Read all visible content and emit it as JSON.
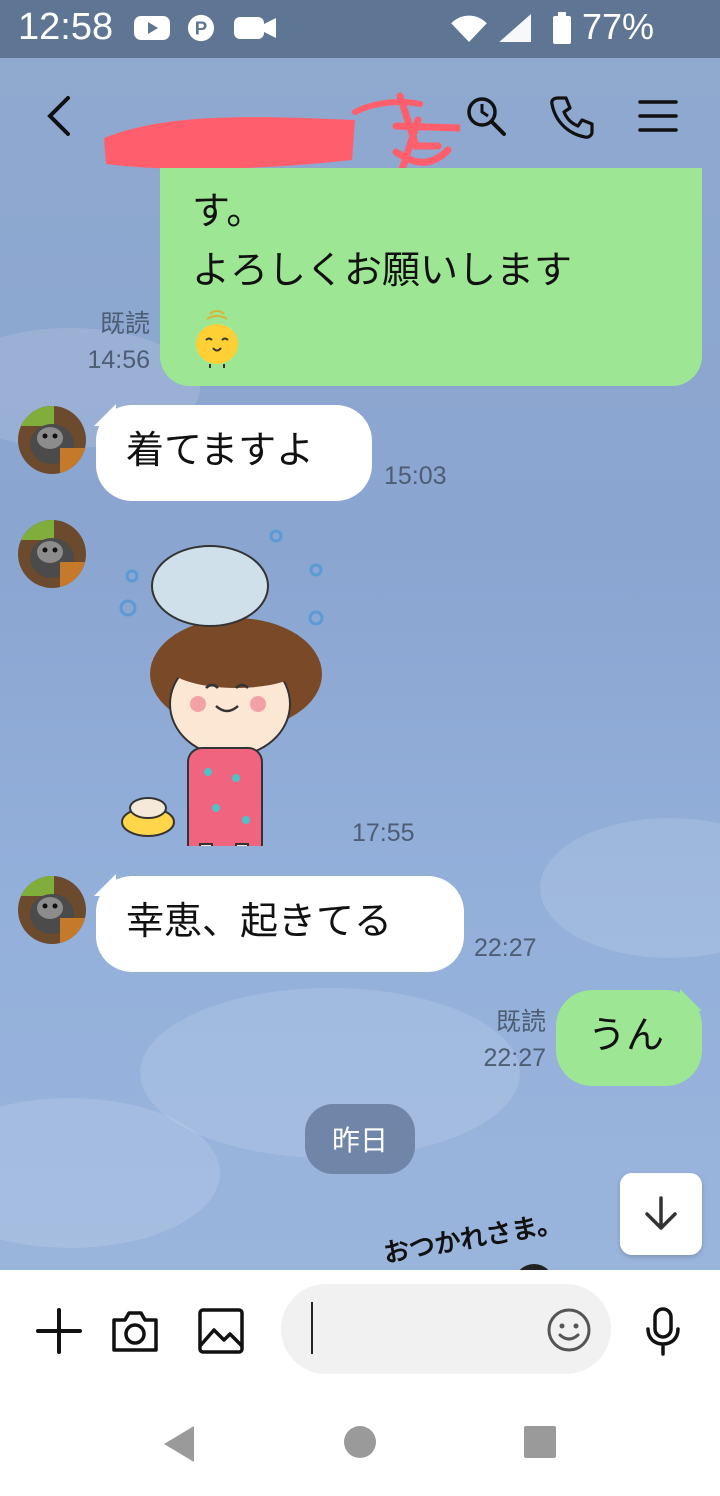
{
  "status_bar": {
    "time": "12:58",
    "battery_percent": "77%",
    "icons": [
      "youtube-icon",
      "pinterest-icon",
      "video-icon",
      "wifi-icon",
      "signal-icon",
      "battery-icon"
    ]
  },
  "header": {
    "contact_name_redacted": true,
    "actions": [
      "back-icon",
      "search-icon",
      "call-icon",
      "menu-icon"
    ]
  },
  "messages": {
    "m1": {
      "direction": "out",
      "text": "す。\nよろしくお願いします",
      "read": "既読",
      "time": "14:56"
    },
    "m2": {
      "direction": "in",
      "text": "着てますよ",
      "time": "15:03"
    },
    "m3": {
      "direction": "in",
      "type": "sticker",
      "time": "17:55"
    },
    "m4": {
      "direction": "in",
      "text": "幸恵、起きてる",
      "time": "22:27"
    },
    "m5": {
      "direction": "out",
      "text": "うん",
      "read": "既読",
      "time": "22:27"
    }
  },
  "date_separator": "昨日",
  "partial_sticker_text": "おつかれさま。",
  "input": {
    "placeholder": ""
  },
  "colors": {
    "chat_background": "#8aa5d0",
    "outgoing_bubble": "#9de693",
    "incoming_bubble": "#ffffff",
    "status_bar": "#5f7594",
    "date_pill": "#6f86a9"
  }
}
